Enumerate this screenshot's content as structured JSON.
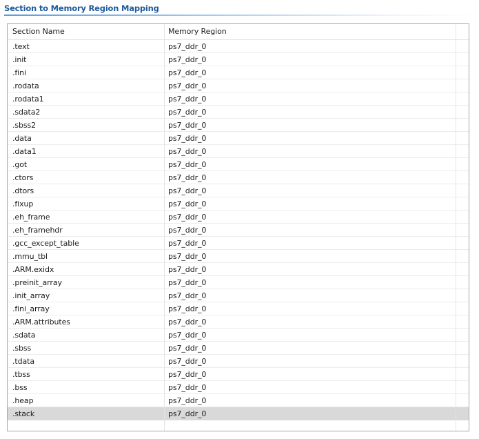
{
  "section": {
    "title": "Section to Memory Region Mapping"
  },
  "table": {
    "columns": [
      "Section Name",
      "Memory Region"
    ],
    "rows": [
      {
        "section": ".text",
        "region": "ps7_ddr_0"
      },
      {
        "section": ".init",
        "region": "ps7_ddr_0"
      },
      {
        "section": ".fini",
        "region": "ps7_ddr_0"
      },
      {
        "section": ".rodata",
        "region": "ps7_ddr_0"
      },
      {
        "section": ".rodata1",
        "region": "ps7_ddr_0"
      },
      {
        "section": ".sdata2",
        "region": "ps7_ddr_0"
      },
      {
        "section": ".sbss2",
        "region": "ps7_ddr_0"
      },
      {
        "section": ".data",
        "region": "ps7_ddr_0"
      },
      {
        "section": ".data1",
        "region": "ps7_ddr_0"
      },
      {
        "section": ".got",
        "region": "ps7_ddr_0"
      },
      {
        "section": ".ctors",
        "region": "ps7_ddr_0"
      },
      {
        "section": ".dtors",
        "region": "ps7_ddr_0"
      },
      {
        "section": ".fixup",
        "region": "ps7_ddr_0"
      },
      {
        "section": ".eh_frame",
        "region": "ps7_ddr_0"
      },
      {
        "section": ".eh_framehdr",
        "region": "ps7_ddr_0"
      },
      {
        "section": ".gcc_except_table",
        "region": "ps7_ddr_0"
      },
      {
        "section": ".mmu_tbl",
        "region": "ps7_ddr_0"
      },
      {
        "section": ".ARM.exidx",
        "region": "ps7_ddr_0"
      },
      {
        "section": ".preinit_array",
        "region": "ps7_ddr_0"
      },
      {
        "section": ".init_array",
        "region": "ps7_ddr_0"
      },
      {
        "section": ".fini_array",
        "region": "ps7_ddr_0"
      },
      {
        "section": ".ARM.attributes",
        "region": "ps7_ddr_0"
      },
      {
        "section": ".sdata",
        "region": "ps7_ddr_0"
      },
      {
        "section": ".sbss",
        "region": "ps7_ddr_0"
      },
      {
        "section": ".tdata",
        "region": "ps7_ddr_0"
      },
      {
        "section": ".tbss",
        "region": "ps7_ddr_0"
      },
      {
        "section": ".bss",
        "region": "ps7_ddr_0"
      },
      {
        "section": ".heap",
        "region": "ps7_ddr_0"
      },
      {
        "section": ".stack",
        "region": "ps7_ddr_0"
      }
    ],
    "selected_row": 28
  }
}
